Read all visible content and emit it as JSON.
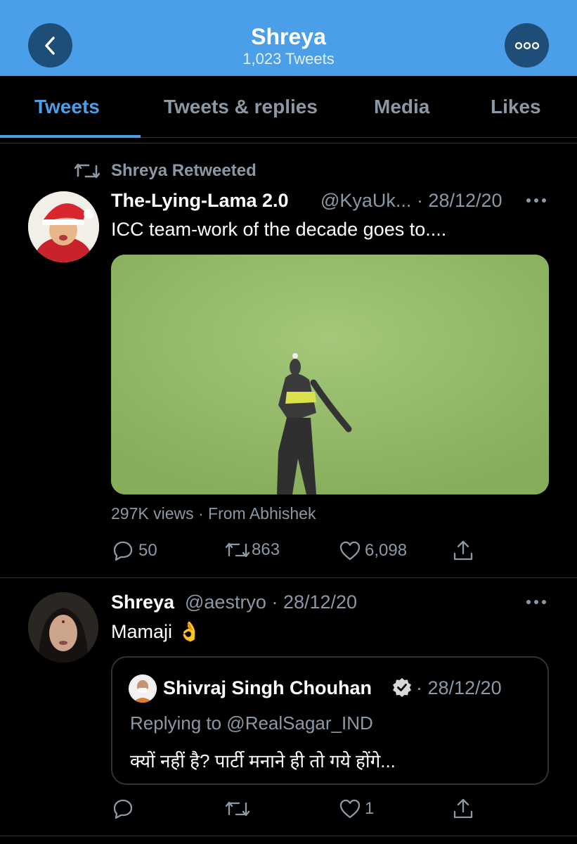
{
  "header": {
    "title": "Shreya",
    "subtitle": "1,023 Tweets",
    "back_icon": "chevron-left-icon",
    "more_icon": "more-icon"
  },
  "tabs": [
    {
      "label": "Tweets",
      "active": true
    },
    {
      "label": "Tweets & replies",
      "active": false
    },
    {
      "label": "Media",
      "active": false
    },
    {
      "label": "Likes",
      "active": false
    }
  ],
  "tweet1": {
    "retweet_label": "Shreya Retweeted",
    "display_name": "The-Lying-Lama 2.0",
    "handle_date": "@KyaUk... · 28/12/20",
    "text": "ICC team-work of the decade goes to....",
    "media_meta": "297K views · From Abhishek",
    "reply_count": "50",
    "retweet_count": "863",
    "like_count": "6,098"
  },
  "tweet2": {
    "display_name": "Shreya",
    "handle_date": "@aestryo · 28/12/20",
    "text": "Mamaji 👌",
    "quote": {
      "display_name": "Shivraj Singh Chouhan",
      "date": "· 28/12/20",
      "replying_to": "Replying to @RealSagar_IND",
      "text": "क्यों नहीं है? पार्टी मनाने ही तो गये होंगे..."
    },
    "reply_count": "",
    "retweet_count": "",
    "like_count": "1"
  },
  "colors": {
    "accent": "#4a9fe8",
    "header_button": "#1e4d78",
    "muted_text": "#8b98a5",
    "divider": "#2f3336",
    "background": "#000000"
  }
}
